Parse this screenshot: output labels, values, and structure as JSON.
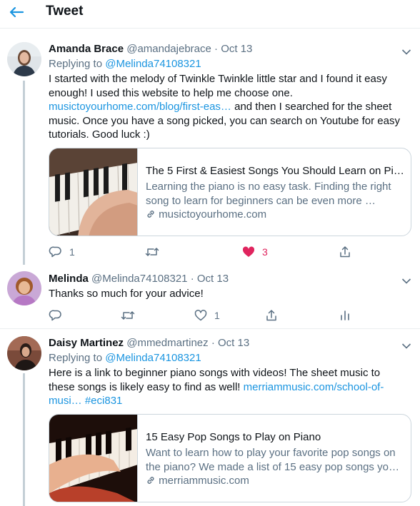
{
  "header": {
    "title": "Tweet"
  },
  "tweets": [
    {
      "name": "Amanda Brace",
      "handle": "@amandajebrace",
      "dot": "·",
      "date": "Oct 13",
      "replying_prefix": "Replying to",
      "replying_to": "@Melinda74108321",
      "text_1": "I started with the melody of Twinkle Twinkle little star and I found it easy enough! I used this website to help me choose one.",
      "link": "musictoyourhome.com/blog/first-eas…",
      "text_2": " and then I searched for the sheet music. Once you have a song picked, you can search on Youtube for easy tutorials. Good luck :)",
      "card": {
        "title": "The 5 First & Easiest Songs You Should Learn on Pi…",
        "description": "Learning the piano is no easy task. Finding the right song to learn for beginners can be even more …",
        "domain": "musictoyourhome.com"
      },
      "actions": {
        "replies": "1",
        "retweets": "",
        "likes": "3"
      }
    },
    {
      "name": "Melinda",
      "handle": "@Melinda74108321",
      "dot": "·",
      "date": "Oct 13",
      "text": "Thanks so much for your advice!",
      "actions": {
        "replies": "",
        "retweets": "",
        "likes": "1"
      }
    },
    {
      "name": "Daisy Martinez",
      "handle": "@mmedmartinez",
      "dot": "·",
      "date": "Oct 13",
      "replying_prefix": "Replying to",
      "replying_to": "@Melinda74108321",
      "text_1": "Here is a link to beginner piano songs with videos! The sheet music to these songs is likely easy to find as well! ",
      "link": "merriammusic.com/school-of-musi…",
      "hashtag": "#eci831",
      "card": {
        "title": "15 Easy Pop Songs to Play on Piano",
        "description": "Want to learn how to play your favorite pop songs on the piano? We made a list of 15 easy pop songs yo…",
        "domain": "merriammusic.com"
      }
    }
  ],
  "colors": {
    "accent": "#1b95e0",
    "like": "#e0245e",
    "secondary": "#5b7083",
    "thread": "#c4cfd6"
  },
  "icons": [
    "back-arrow-icon",
    "chevron-down-icon",
    "reply-icon",
    "retweet-icon",
    "heart-icon",
    "heart-filled-icon",
    "share-icon",
    "analytics-icon",
    "link-icon"
  ]
}
